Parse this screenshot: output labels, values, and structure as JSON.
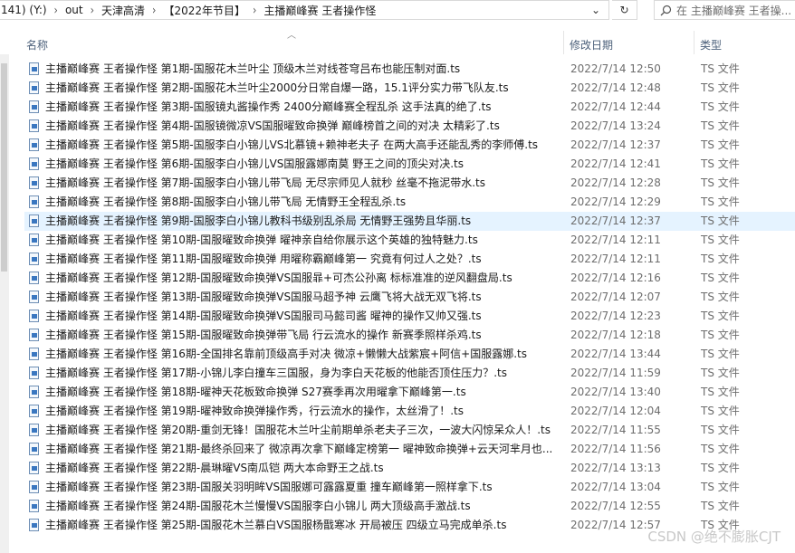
{
  "address_bar": {
    "crumbs": [
      "141) (Y:)",
      "out",
      "天津高清",
      "【2022年节目】",
      "主播巅峰赛 王者操作怪"
    ],
    "search_placeholder": "在 主播巅峰赛 王者操..."
  },
  "columns": {
    "name": "名称",
    "date": "修改日期",
    "type": "类型"
  },
  "files": [
    {
      "name": "主播巅峰赛 王者操作怪 第1期-国服花木兰叶尘 顶级木兰对线苍穹吕布也能压制对面.ts",
      "date": "2022/7/14 12:50",
      "type": "TS 文件"
    },
    {
      "name": "主播巅峰赛 王者操作怪 第2期-国服花木兰叶尘2000分日常自爆一路，15.1评分实力带飞队友.ts",
      "date": "2022/7/14 12:48",
      "type": "TS 文件"
    },
    {
      "name": "主播巅峰赛 王者操作怪 第3期-国服镜丸酱操作秀 2400分巅峰赛全程乱杀 这手法真的绝了.ts",
      "date": "2022/7/14 12:44",
      "type": "TS 文件"
    },
    {
      "name": "主播巅峰赛 王者操作怪 第4期-国服镜微凉VS国服曜致命换弹 巅峰榜首之间的对决 太精彩了.ts",
      "date": "2022/7/14 13:24",
      "type": "TS 文件"
    },
    {
      "name": "主播巅峰赛 王者操作怪 第5期-国服李白小锦儿VS北慕镜+赖神老夫子 在两大高手还能乱秀的李师傅.ts",
      "date": "2022/7/14 12:37",
      "type": "TS 文件"
    },
    {
      "name": "主播巅峰赛 王者操作怪 第6期-国服李白小锦儿VS国服露娜南莫 野王之间的顶尖对决.ts",
      "date": "2022/7/14 12:41",
      "type": "TS 文件"
    },
    {
      "name": "主播巅峰赛 王者操作怪 第7期-国服李白小锦儿带飞局 无尽宗师见人就秒 丝毫不拖泥带水.ts",
      "date": "2022/7/14 12:28",
      "type": "TS 文件"
    },
    {
      "name": "主播巅峰赛 王者操作怪 第8期-国服李白小锦儿带飞局 无情野王全程乱杀.ts",
      "date": "2022/7/14 12:29",
      "type": "TS 文件"
    },
    {
      "name": "主播巅峰赛 王者操作怪 第9期-国服李白小锦儿教科书级别乱杀局 无情野王强势且华丽.ts",
      "date": "2022/7/14 12:37",
      "type": "TS 文件",
      "selected": true
    },
    {
      "name": "主播巅峰赛 王者操作怪 第10期-国服曜致命换弹 曜神亲自给你展示这个英雄的独特魅力.ts",
      "date": "2022/7/14 12:11",
      "type": "TS 文件"
    },
    {
      "name": "主播巅峰赛 王者操作怪 第11期-国服曜致命换弹 用曜称霸巅峰第一 究竟有何过人之处？.ts",
      "date": "2022/7/14 12:11",
      "type": "TS 文件"
    },
    {
      "name": "主播巅峰赛 王者操作怪 第12期-国服曜致命换弹VS国服暃+可杰公孙离 标标准准的逆风翻盘局.ts",
      "date": "2022/7/14 12:16",
      "type": "TS 文件"
    },
    {
      "name": "主播巅峰赛 王者操作怪 第13期-国服曜致命换弹VS国服马超予神 云鹰飞将大战无双飞将.ts",
      "date": "2022/7/14 12:07",
      "type": "TS 文件"
    },
    {
      "name": "主播巅峰赛 王者操作怪 第14期-国服曜致命换弹VS国服司马懿司酱 曜神的操作又帅又强.ts",
      "date": "2022/7/14 12:23",
      "type": "TS 文件"
    },
    {
      "name": "主播巅峰赛 王者操作怪 第15期-国服曜致命换弹带飞局 行云流水的操作 新赛季照样杀鸡.ts",
      "date": "2022/7/14 12:18",
      "type": "TS 文件"
    },
    {
      "name": "主播巅峰赛 王者操作怪 第16期-全国排名靠前顶级高手对决 微凉+懒懒大战紫宸+阿信+国服露娜.ts",
      "date": "2022/7/14 13:44",
      "type": "TS 文件"
    },
    {
      "name": "主播巅峰赛 王者操作怪 第17期-小锦儿李白撞车三国服，身为李白天花板的他能否顶住压力？.ts",
      "date": "2022/7/14 11:59",
      "type": "TS 文件"
    },
    {
      "name": "主播巅峰赛 王者操作怪 第18期-曜神天花板致命换弹 S27赛季再次用曜拿下巅峰第一.ts",
      "date": "2022/7/14 13:40",
      "type": "TS 文件"
    },
    {
      "name": "主播巅峰赛 王者操作怪 第19期-曜神致命换弹操作秀，行云流水的操作，太丝滑了！.ts",
      "date": "2022/7/14 12:04",
      "type": "TS 文件"
    },
    {
      "name": "主播巅峰赛 王者操作怪 第20期-重剑无锋！国服花木兰叶尘前期单杀老夫子三次，一波大闪惊呆众人！.ts",
      "date": "2022/7/14 11:55",
      "type": "TS 文件"
    },
    {
      "name": "主播巅峰赛 王者操作怪 第21期-最终杀回来了 微凉再次拿下巅峰定榜第一 曜神致命换弹+云天河芈月也...",
      "date": "2022/7/14 11:56",
      "type": "TS 文件"
    },
    {
      "name": "主播巅峰赛 王者操作怪 第22期-晨琳曜VS南瓜铠 两大本命野王之战.ts",
      "date": "2022/7/14 13:13",
      "type": "TS 文件"
    },
    {
      "name": "主播巅峰赛 王者操作怪 第23期-国服关羽明眸VS国服娜可露露夏重 撞车巅峰第一照样拿下.ts",
      "date": "2022/7/14 13:04",
      "type": "TS 文件"
    },
    {
      "name": "主播巅峰赛 王者操作怪 第24期-国服花木兰慢慢VS国服李白小锦儿 两大顶级高手激战.ts",
      "date": "2022/7/14 12:55",
      "type": "TS 文件"
    },
    {
      "name": "主播巅峰赛 王者操作怪 第25期-国服花木兰慕白VS国服杨戬寒冰 开局被压 四级立马完成单杀.ts",
      "date": "2022/7/14 12:57",
      "type": "TS 文件"
    }
  ],
  "watermark": "CSDN @绝不膨胀CJT"
}
